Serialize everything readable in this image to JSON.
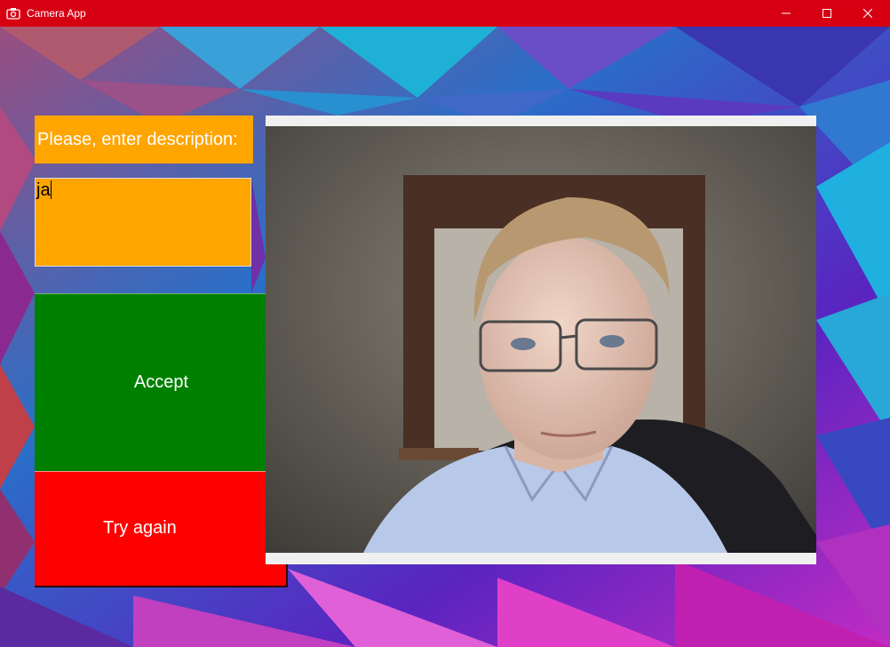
{
  "window": {
    "title": "Camera App",
    "icon": "camera-icon",
    "titlebar_color": "#d60012"
  },
  "form": {
    "description_label": "Please, enter description:",
    "description_value": "ja"
  },
  "buttons": {
    "accept_label": "Accept",
    "accept_color": "#008000",
    "retry_label": "Try again",
    "retry_color": "#ff0000"
  },
  "preview": {
    "content": "webcam-photo"
  },
  "colors": {
    "label_bg": "#ffa500"
  }
}
